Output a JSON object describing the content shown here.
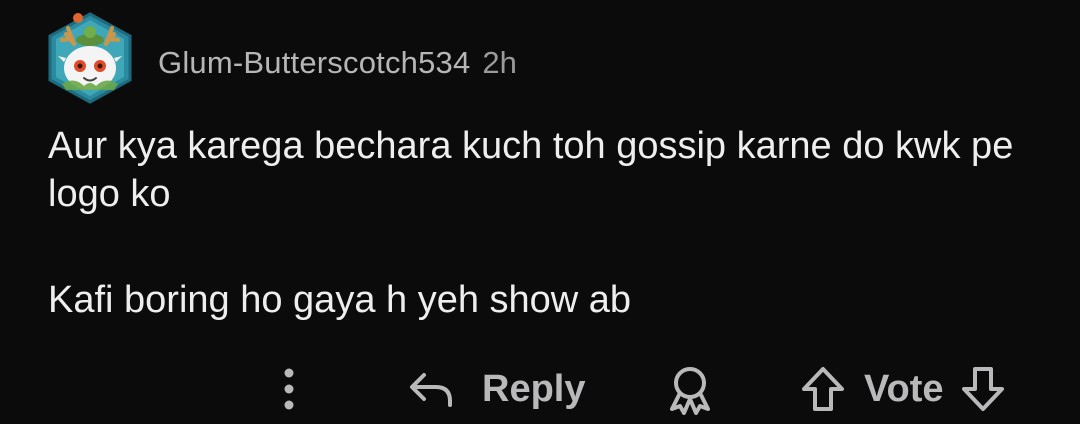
{
  "comment": {
    "author": "Glum-Butterscotch534",
    "timestamp": "2h",
    "paragraphs": [
      "Aur kya karega bechara kuch toh gossip karne do kwk pe logo ko",
      "Kafi boring ho gaya h yeh show ab"
    ]
  },
  "actions": {
    "more_icon": "vertical-ellipsis-icon",
    "reply_icon": "reply-arrow-icon",
    "reply_label": "Reply",
    "award_icon": "award-icon",
    "upvote_icon": "upvote-arrow-icon",
    "vote_label": "Vote",
    "downvote_icon": "downvote-arrow-icon"
  },
  "colors": {
    "background": "#0b0b0c",
    "text": "#eeeeee",
    "muted": "#b6b6b8",
    "avatar_ring": "#1f8a9a"
  }
}
